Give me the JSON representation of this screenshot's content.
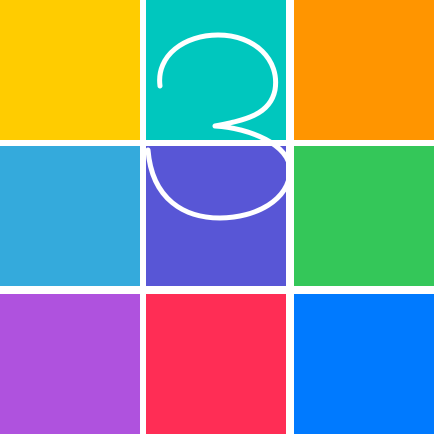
{
  "logo": {
    "digit": "3",
    "digit_color": "#ffffff"
  },
  "tiles": [
    {
      "name": "tile-yellow",
      "color": "#FFCC00"
    },
    {
      "name": "tile-teal",
      "color": "#00C7BE"
    },
    {
      "name": "tile-orange",
      "color": "#FF9500"
    },
    {
      "name": "tile-light-blue",
      "color": "#34AADC"
    },
    {
      "name": "tile-indigo",
      "color": "#5856D6"
    },
    {
      "name": "tile-green",
      "color": "#34C759"
    },
    {
      "name": "tile-purple",
      "color": "#AF52DE"
    },
    {
      "name": "tile-pink",
      "color": "#FF2D55"
    },
    {
      "name": "tile-blue",
      "color": "#007AFF"
    }
  ]
}
